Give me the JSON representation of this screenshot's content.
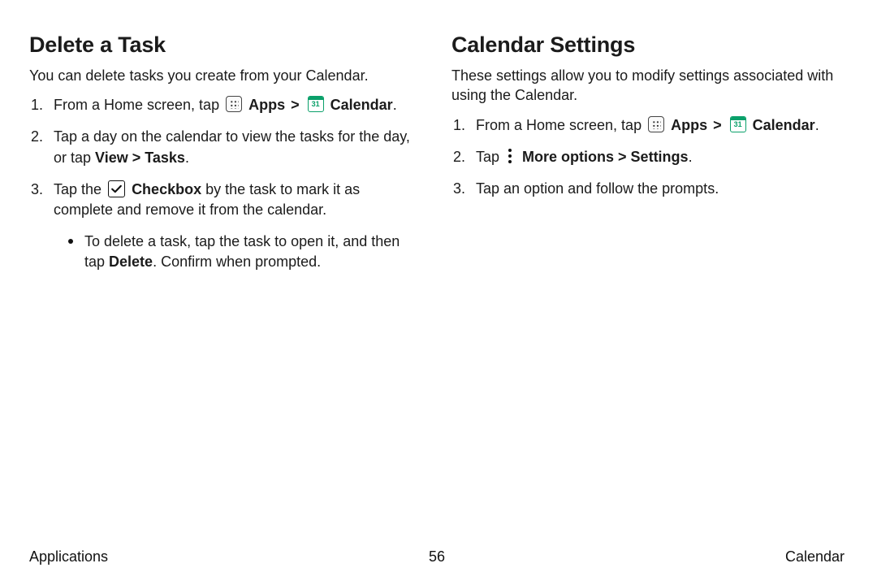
{
  "left": {
    "heading": "Delete a Task",
    "intro": "You can delete tasks you create from your Calendar.",
    "step1_pre": "From a Home screen, tap ",
    "apps": "Apps",
    "chev": ">",
    "calendar": "Calendar",
    "period": ".",
    "step2_a": "Tap a day on the calendar to view the tasks for the day, or tap ",
    "step2_b": "View > Tasks",
    "step3_a": "Tap the ",
    "step3_b": "Checkbox",
    "step3_c": " by the task to mark it as complete and remove it from the calendar.",
    "bullet_a": "To delete a task, tap the task to open it, and then tap ",
    "bullet_b": "Delete",
    "bullet_c": ". Confirm when prompted."
  },
  "right": {
    "heading": "Calendar Settings",
    "intro": "These settings allow you to modify settings associated with using the Calendar.",
    "step1_pre": "From a Home screen, tap ",
    "apps": "Apps",
    "chev": ">",
    "calendar": "Calendar",
    "period": ".",
    "step2_a": "Tap ",
    "step2_b": "More options > Settings",
    "step3": "Tap an option and follow the prompts."
  },
  "footer": {
    "left": "Applications",
    "center": "56",
    "right": "Calendar"
  }
}
